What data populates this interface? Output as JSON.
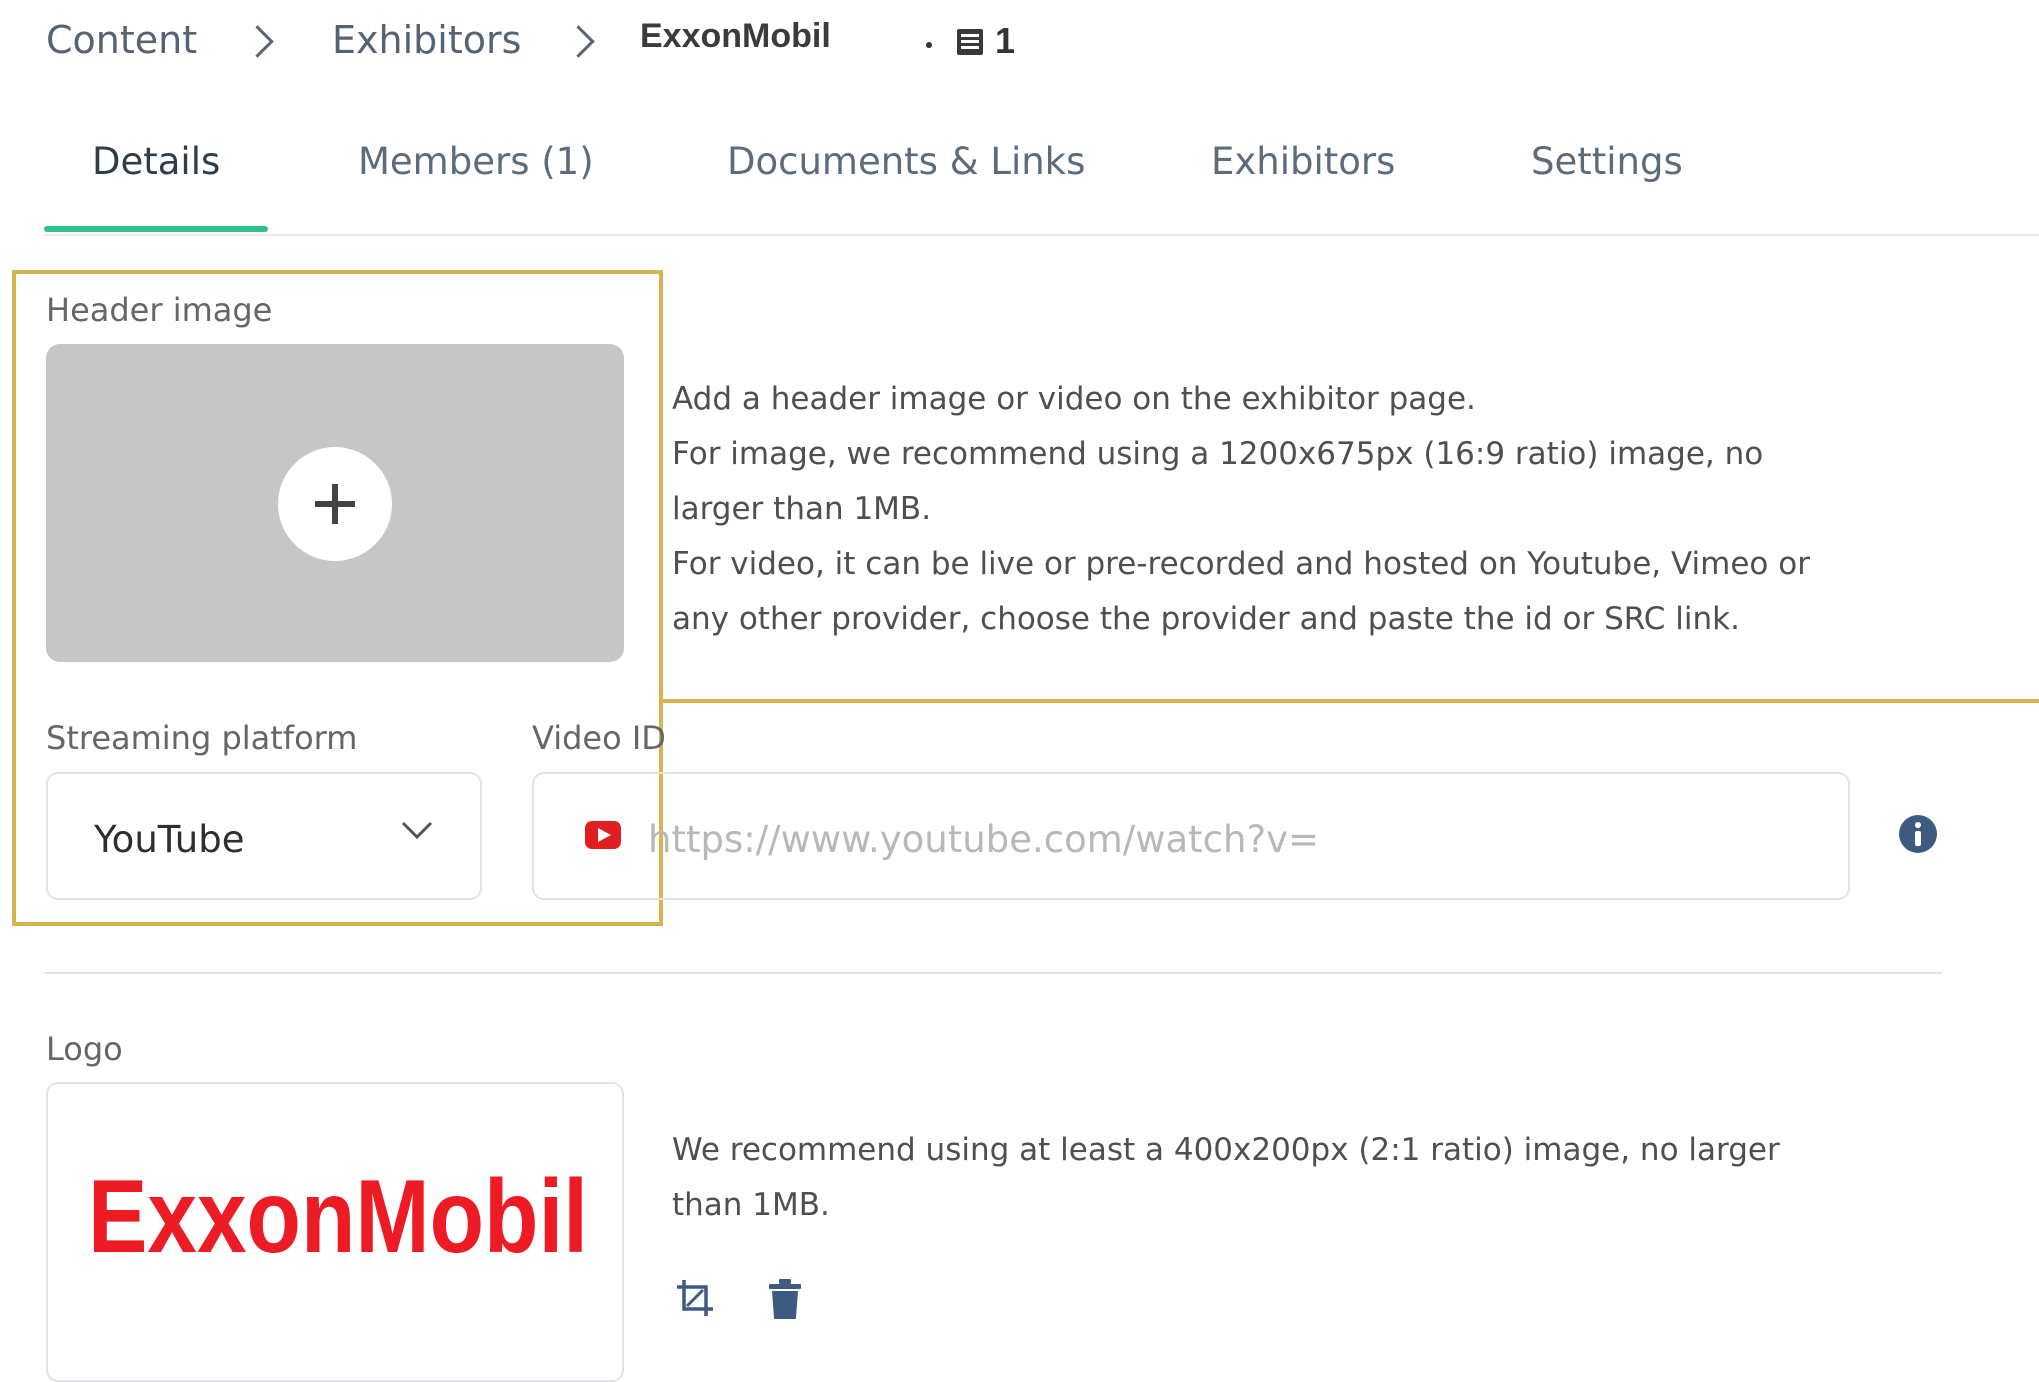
{
  "breadcrumb": {
    "items": [
      "Content",
      "Exhibitors"
    ],
    "current": "ExxonMobil",
    "count": "1"
  },
  "tabs": [
    {
      "label": "Details",
      "active": true
    },
    {
      "label": "Members (1)",
      "active": false
    },
    {
      "label": "Documents & Links",
      "active": false
    },
    {
      "label": "Exhibitors",
      "active": false
    },
    {
      "label": "Settings",
      "active": false
    }
  ],
  "header_image": {
    "label": "Header image",
    "help": [
      "Add a header image or video on the exhibitor page.",
      "For image, we recommend using a 1200x675px (16:9 ratio) image, no",
      "larger than 1MB.",
      "For video, it can be live or pre-recorded and hosted on Youtube, Vimeo or",
      "any other provider, choose the provider and paste the id or SRC link."
    ]
  },
  "streaming": {
    "label": "Streaming platform",
    "value": "YouTube"
  },
  "video": {
    "label": "Video ID",
    "placeholder": "https://www.youtube.com/watch?v="
  },
  "logo": {
    "label": "Logo",
    "image_text": "ExxonMobil",
    "help": [
      "We recommend using at least a 400x200px (2:1 ratio) image, no larger",
      "than 1MB."
    ]
  },
  "colors": {
    "accent": "#2fbf8f",
    "highlight": "#d6b550",
    "youtube_red": "#e02020",
    "exxon_red": "#ed1c24",
    "info_blue": "#3d5a80"
  }
}
